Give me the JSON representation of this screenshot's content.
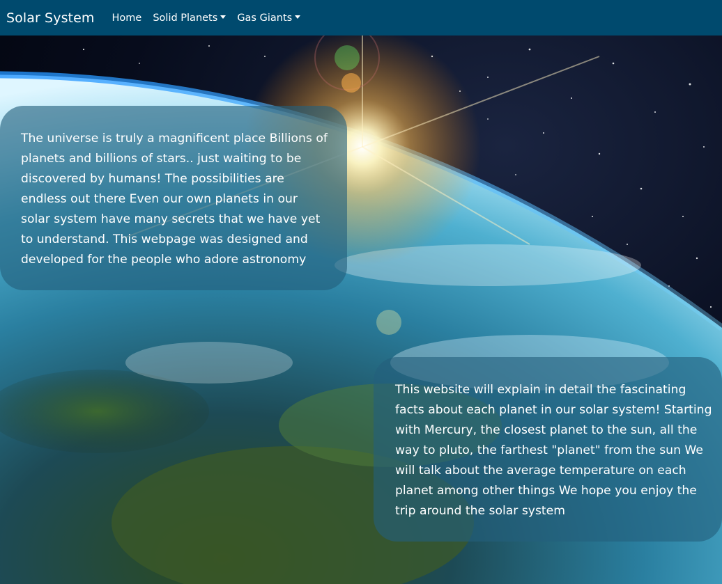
{
  "navbar": {
    "brand": "Solar System",
    "items": [
      {
        "label": "Home",
        "has_dropdown": false
      },
      {
        "label": "Solid Planets",
        "has_dropdown": true
      },
      {
        "label": "Gas Giants",
        "has_dropdown": true
      }
    ],
    "background_color": "#004a6e"
  },
  "hero": {
    "background": "earth-from-space-with-sunrise"
  },
  "intro_box": {
    "text": "The universe is truly a magnificent place Billions of planets and billions of stars.. just waiting to be discovered by humans! The possibilities are endless out there Even our own planets in our solar system have many secrets that we have yet to understand. This webpage was designed and developed for the people who adore astronomy"
  },
  "detail_box": {
    "text": "This website will explain in detail the fascinating facts about each planet in our solar system! Starting with Mercury, the closest planet to the sun, all the way to pluto, the farthest \"planet\" from the sun We will talk about the average temperature on each planet among other things We hope you enjoy the trip around the solar system"
  }
}
